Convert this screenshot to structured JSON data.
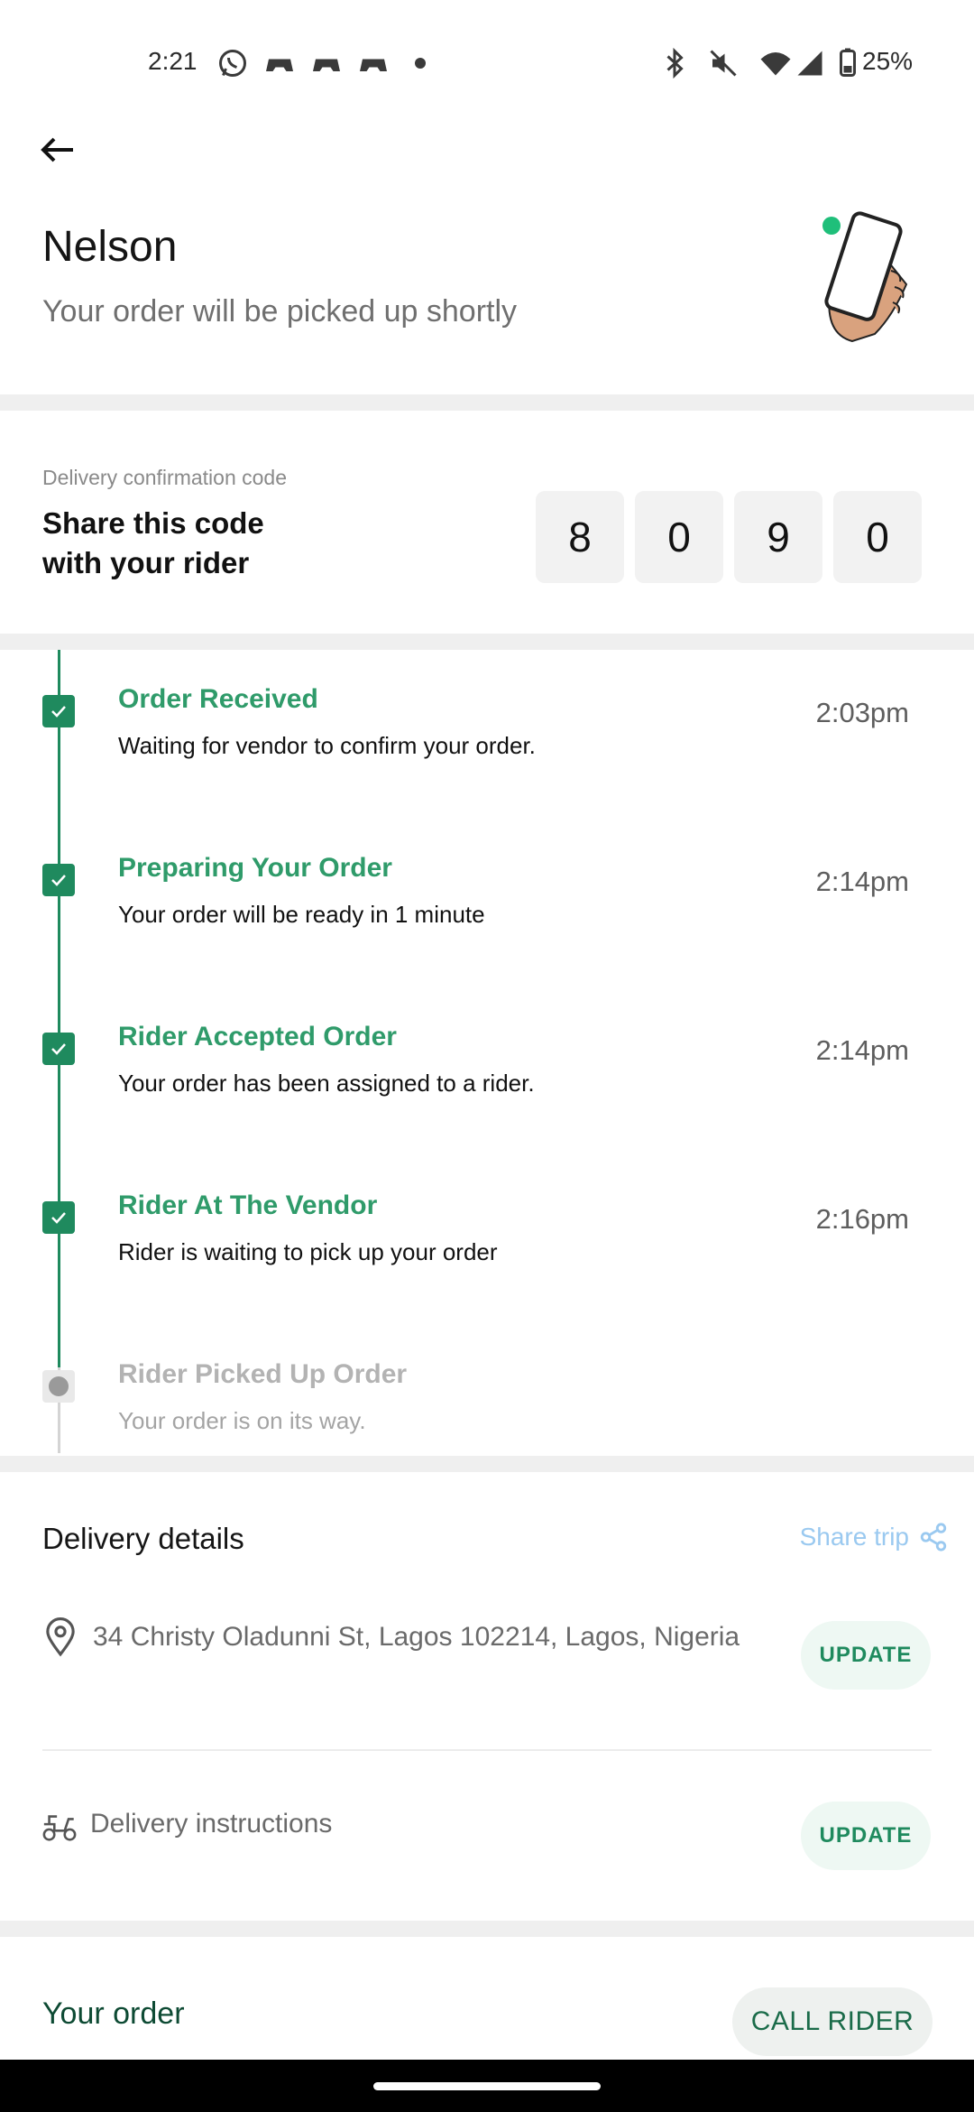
{
  "status_bar": {
    "time": "2:21",
    "battery": "25%",
    "notification_icons": [
      "whatsapp-icon",
      "game-controller-icon",
      "game-controller-icon",
      "game-controller-icon",
      "dot-icon"
    ],
    "system_icons": [
      "bluetooth-icon",
      "mute-icon",
      "wifi-icon",
      "signal-icon",
      "battery-icon"
    ]
  },
  "header": {
    "name": "Nelson",
    "subtitle": "Your order will be picked up shortly"
  },
  "code_section": {
    "label": "Delivery confirmation code",
    "instruction": "Share this code with your rider",
    "digits": [
      "8",
      "0",
      "9",
      "0"
    ]
  },
  "timeline": [
    {
      "title": "Order Received",
      "desc": "Waiting for vendor to confirm your order.",
      "time": "2:03pm",
      "done": true
    },
    {
      "title": "Preparing Your Order",
      "desc": "Your order will be ready in 1 minute",
      "time": "2:14pm",
      "done": true
    },
    {
      "title": "Rider Accepted Order",
      "desc": "Your order has been assigned to a rider.",
      "time": "2:14pm",
      "done": true
    },
    {
      "title": "Rider At The Vendor",
      "desc": "Rider is waiting to pick up your order",
      "time": "2:16pm",
      "done": true
    },
    {
      "title": "Rider Picked Up Order",
      "desc": "Your order is on its way.",
      "time": "",
      "done": false
    }
  ],
  "delivery": {
    "title": "Delivery details",
    "share_label": "Share trip",
    "address": "34 Christy Oladunni St, Lagos 102214, Lagos, Nigeria",
    "instructions_label": "Delivery instructions",
    "update_label": "UPDATE"
  },
  "order": {
    "title": "Your order",
    "call_rider_label": "CALL RIDER"
  },
  "colors": {
    "brand_green": "#1f8a5e",
    "step_title_green": "#2f9b6a",
    "share_blue": "#9ac9f0"
  }
}
